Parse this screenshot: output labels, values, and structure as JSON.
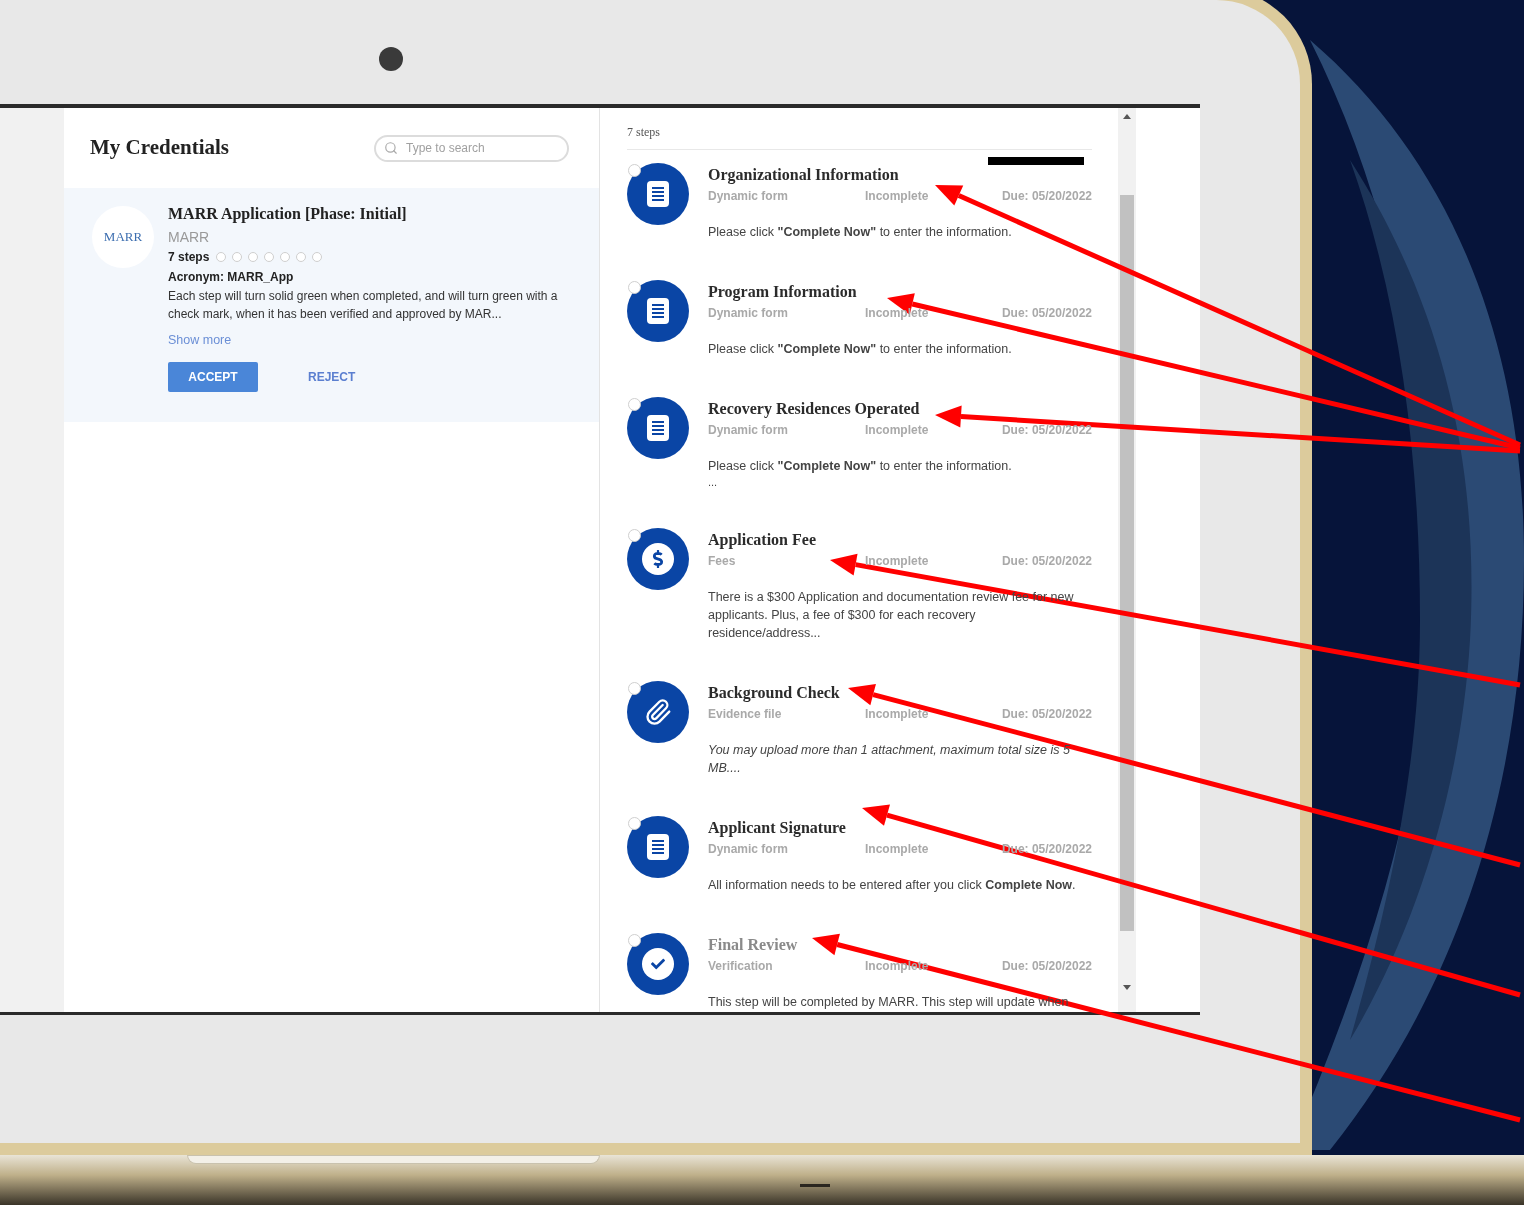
{
  "credentials": {
    "title": "My Credentials",
    "search": {
      "placeholder": "Type to search"
    },
    "item": {
      "logo_text": "MARR",
      "title": "MARR Application [Phase: Initial]",
      "issuer": "MARR",
      "steps_label": "7 steps",
      "step_dots": [
        {
          "completed": false
        },
        {
          "completed": false
        },
        {
          "completed": false
        },
        {
          "completed": false
        },
        {
          "completed": false
        },
        {
          "completed": false
        },
        {
          "completed": false
        }
      ],
      "acronym": "Acronym: MARR_App",
      "description": "Each step will turn solid green when completed, and will turn green with a check mark, when it has been verified and approved by MAR...",
      "show_more": "Show more",
      "buttons": [
        {
          "label": "ACCEPT",
          "kind": "primary"
        },
        {
          "label": "REJECT",
          "kind": "text"
        }
      ]
    }
  },
  "steps_panel": {
    "count": "7 steps",
    "steps": [
      {
        "kind": "form",
        "title": "Organizational Information",
        "type": "Dynamic form",
        "status": "Incomplete",
        "due": "Due: 05/20/2022",
        "description": "Please click **\"Complete Now\"** to enter the information.",
        "italic": false,
        "disabled": false,
        "redacted": true,
        "checked": false
      },
      {
        "kind": "form",
        "title": "Program Information",
        "type": "Dynamic form",
        "status": "Incomplete",
        "due": "Due: 05/20/2022",
        "description": "Please click **\"Complete Now\"** to enter the information.",
        "italic": false,
        "disabled": false,
        "redacted": false,
        "checked": false
      },
      {
        "kind": "form",
        "title": "Recovery Residences Operated",
        "type": "Dynamic form",
        "status": "Incomplete",
        "due": "Due: 05/20/2022",
        "description": "Please click **\"Complete Now\"** to enter the information.",
        "more": "...",
        "italic": false,
        "disabled": false,
        "redacted": false,
        "checked": false
      },
      {
        "kind": "fees",
        "title": "Application Fee",
        "type": "Fees",
        "status": "Incomplete",
        "due": "Due: 05/20/2022",
        "description": "There is a $300 Application and documentation review fee for new applicants. Plus, a fee of $300 for each recovery residence/address...",
        "italic": false,
        "disabled": false,
        "redacted": false,
        "checked": false
      },
      {
        "kind": "file",
        "title": "Background Check",
        "type": "Evidence file",
        "status": "Incomplete",
        "due": "Due: 05/20/2022",
        "description": "You may upload more than 1 attachment, maximum total size is 5 MB....",
        "italic": true,
        "disabled": false,
        "redacted": false,
        "checked": false
      },
      {
        "kind": "form",
        "title": "Applicant Signature",
        "type": "Dynamic form",
        "status": "Incomplete",
        "due": "Due: 05/20/2022",
        "description": "All information needs to be entered after you click **Complete Now**.",
        "italic": false,
        "disabled": false,
        "redacted": false,
        "checked": false
      },
      {
        "kind": "verification",
        "title": "Final Review",
        "type": "Verification",
        "status": "Incomplete",
        "due": "Due: 05/20/2022",
        "description": "This step will be completed by MARR. This step will update when",
        "italic": false,
        "disabled": true,
        "redacted": false,
        "checked": false
      }
    ]
  }
}
